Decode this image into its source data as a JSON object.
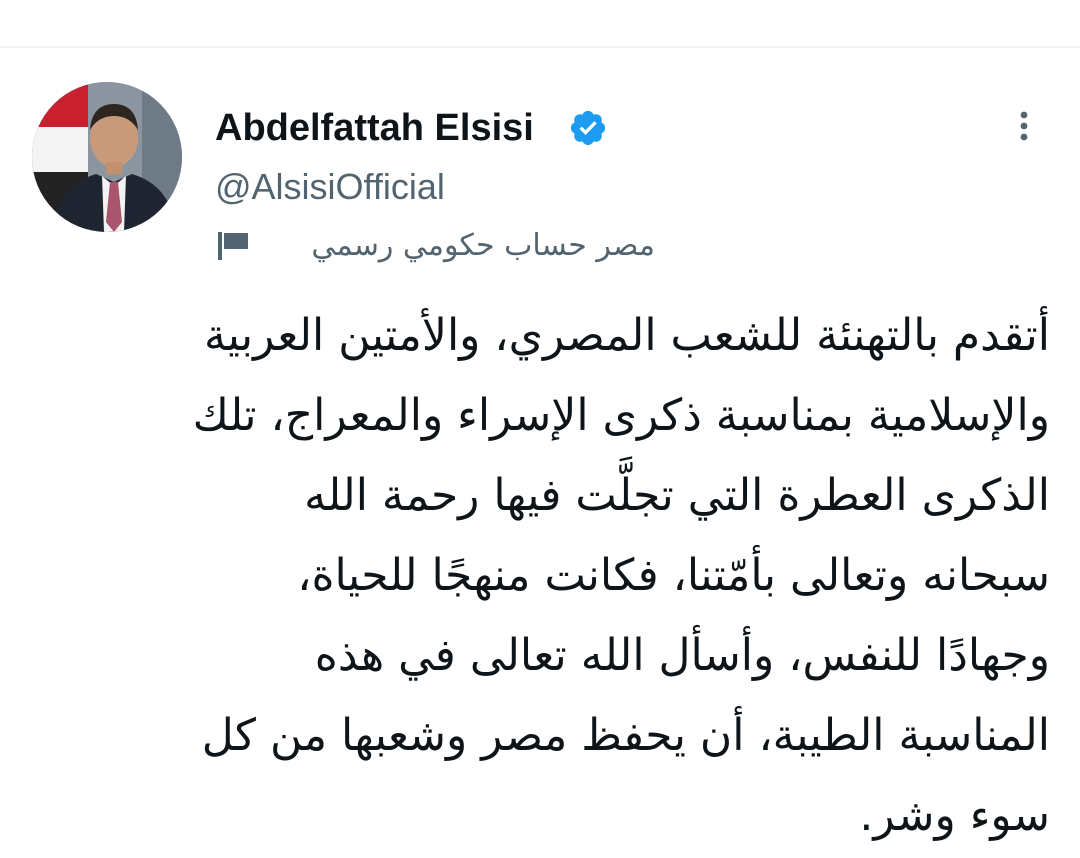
{
  "tweet": {
    "author": {
      "display_name": "Abdelfattah Elsisi",
      "handle": "@AlsisiOfficial",
      "verified_icon": "verified-badge-icon",
      "avatar_icon": "profile-photo-avatar"
    },
    "account_label": {
      "icon": "flag-icon",
      "text": "مصر حساب حكومي رسمي"
    },
    "more_menu_icon": "more-vertical-icon",
    "text": "أتقدم بالتهنئة للشعب المصري، والأمتين العربية\nوالإسلامية بمناسبة ذكرى الإسراء والمعراج، تلك\nالذكرى العطرة التي تجلَّت فيها رحمة الله\nسبحانه وتعالى بأمّتنا، فكانت منهجًا للحياة،\nوجهادًا للنفس، وأسأل الله تعالى في هذه\nالمناسبة الطيبة، أن يحفظ مصر وشعبها من كل\nسوء وشر."
  },
  "colors": {
    "verified_blue": "#1d9bf0",
    "secondary_text": "#536471",
    "primary_text": "#0f1419",
    "divider": "#eff3f4"
  }
}
